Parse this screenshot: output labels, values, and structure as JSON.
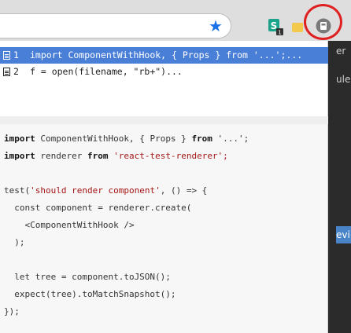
{
  "toolbar": {
    "star_icon": "bookmark-star-icon",
    "ext_s_label": "S",
    "ext_s_badge": "1",
    "highlight_color": "#e02020"
  },
  "sidebar": {
    "snippet_1": "er",
    "snippet_2": "ule",
    "snippet_3": "evi"
  },
  "suggestions": [
    {
      "num": "1",
      "text": "import ComponentWithHook, { Props } from '...';...",
      "selected": true
    },
    {
      "num": "2",
      "text": "f = open(filename, \"rb+\")...",
      "selected": false
    }
  ],
  "code": {
    "l1_kw1": "import",
    "l1_mid": " ComponentWithHook, { Props } ",
    "l1_kw2": "from",
    "l1_str": " '...';",
    "l2_kw1": "import",
    "l2_mid": " renderer ",
    "l2_kw2": "from",
    "l2_str": " 'react-test-renderer';",
    "l3_a": "test(",
    "l3_str": "'should render component'",
    "l3_b": ", () => {",
    "l4": "  const component = renderer.create(",
    "l5": "    <ComponentWithHook />",
    "l6": "  );",
    "l7": "  let tree = component.toJSON();",
    "l8": "  expect(tree).toMatchSnapshot();",
    "l9": "});"
  }
}
